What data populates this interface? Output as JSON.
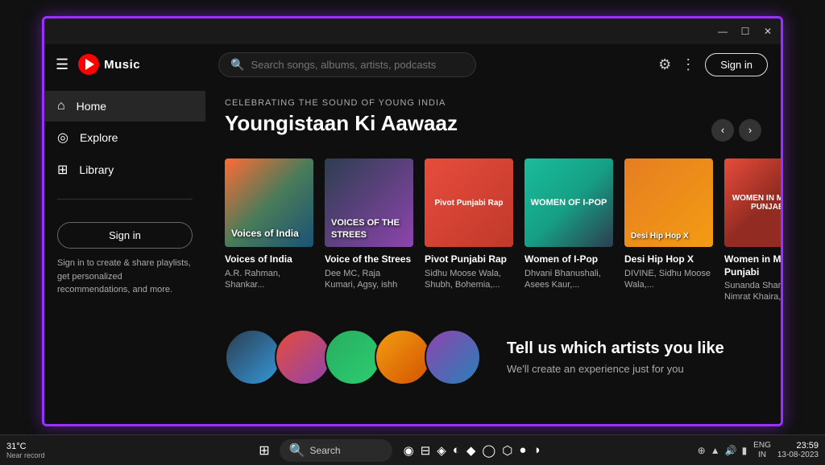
{
  "app": {
    "title": "YouTube Music",
    "logo_text": "Music"
  },
  "titlebar": {
    "minimize": "—",
    "maximize": "☐",
    "close": "✕"
  },
  "sidebar": {
    "hamburger": "☰",
    "nav_items": [
      {
        "id": "home",
        "label": "Home",
        "icon": "⌂",
        "active": true
      },
      {
        "id": "explore",
        "label": "Explore",
        "icon": "◎"
      },
      {
        "id": "library",
        "label": "Library",
        "icon": "⊞"
      }
    ],
    "signin_button": "Sign in",
    "signin_description": "Sign in to create & share playlists, get personalized recommendations, and more."
  },
  "topbar": {
    "search_placeholder": "Search songs, albums, artists, podcasts",
    "signin_button": "Sign in"
  },
  "featured_section": {
    "subtitle": "CELEBRATING THE SOUND OF YOUNG INDIA",
    "title": "Youngistaan Ki Aawaaz",
    "cards": [
      {
        "id": "voices-of-india",
        "title": "Voices of India",
        "subtitle": "A.R. Rahman, Shankar...",
        "label": "Voices of India",
        "color_class": "card-bg-1"
      },
      {
        "id": "voice-of-strees",
        "title": "Voice of the Strees",
        "subtitle": "Dee MC, Raja Kumari, Agsy, ishh",
        "label": "VOICES OF THE STREES",
        "color_class": "card-bg-2"
      },
      {
        "id": "pivot-punjabi-rap",
        "title": "Pivot Punjabi Rap",
        "subtitle": "Sidhu Moose Wala, Shubh, Bohemia,...",
        "label": "Pivot Punjabi Rap",
        "color_class": "card-bg-3"
      },
      {
        "id": "women-of-ipop",
        "title": "Women of I-Pop",
        "subtitle": "Dhvani Bhanushali, Asees Kaur,...",
        "label": "WOMEN OF I-POP",
        "color_class": "card-bg-4"
      },
      {
        "id": "desi-hip-hop-x",
        "title": "Desi Hip Hop X",
        "subtitle": "DIVINE, Sidhu Moose Wala,...",
        "label": "Desi Hip Hop X",
        "color_class": "card-bg-5"
      },
      {
        "id": "women-in-music-punjabi",
        "title": "Women in Music: Punjabi",
        "subtitle": "Sunanda Sharma, Nimrat Khaira,...",
        "label": "WOMEN IN MUSIC: PUNJABI",
        "color_class": "card-bg-6"
      }
    ]
  },
  "artist_section": {
    "title": "Tell us which artists you like",
    "subtitle": "We'll create an experience just for you"
  },
  "taskbar": {
    "weather_temp": "31°C",
    "weather_desc": "Near record",
    "search_text": "Search",
    "windows_icon": "⊞",
    "language": "ENG\nIN",
    "time": "23:59",
    "date": "13-08-2023"
  }
}
